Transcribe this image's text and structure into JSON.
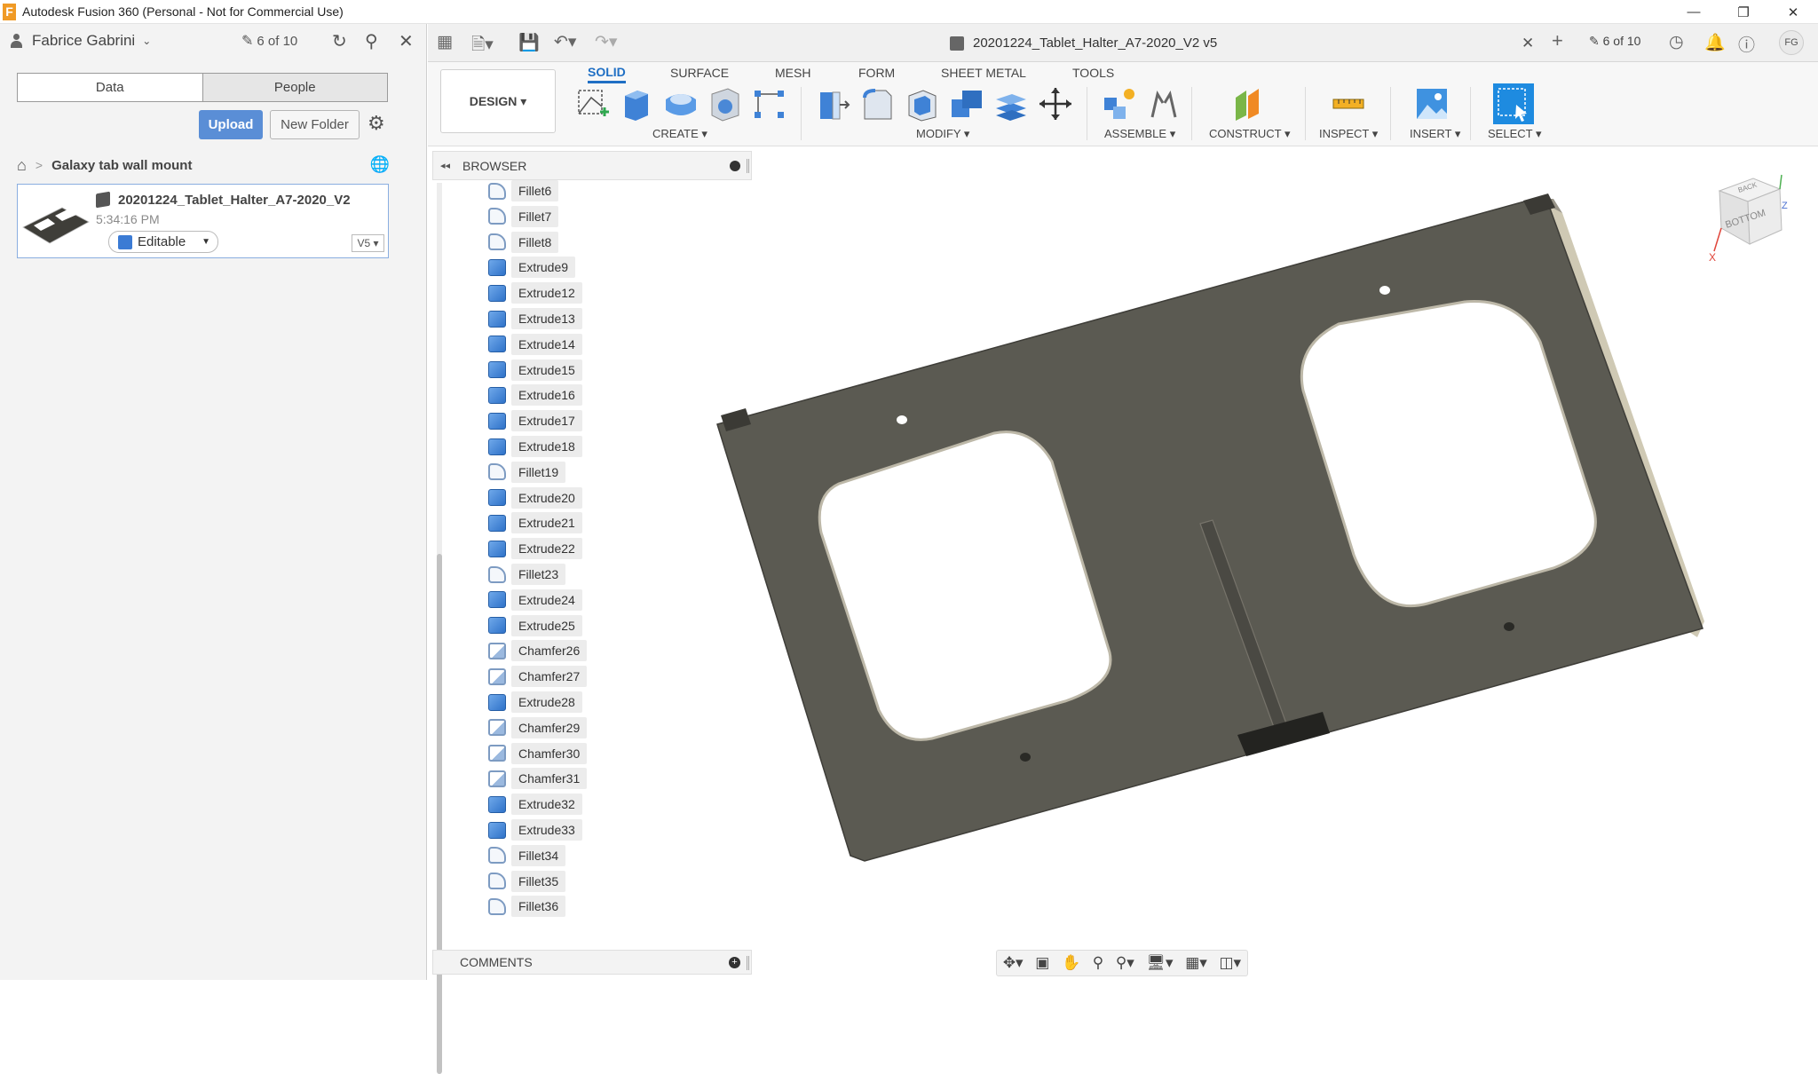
{
  "window": {
    "title": "Autodesk Fusion 360 (Personal - Not for Commercial Use)",
    "logo_letter": "F",
    "minimize": "—",
    "restore": "❐",
    "close": "✕"
  },
  "data_panel": {
    "user_name": "Fabrice Gabrini",
    "user_caret": "⌄",
    "counter": "6 of 10",
    "tabs": {
      "data": "Data",
      "people": "People"
    },
    "upload_label": "Upload",
    "new_folder_label": "New Folder",
    "breadcrumb": {
      "project": "Galaxy tab wall mount",
      "sep": ">"
    },
    "file": {
      "name": "20201224_Tablet_Halter_A7-2020_V2",
      "time": "5:34:16 PM",
      "status": "Editable",
      "version": "V5 ▾"
    }
  },
  "tabbar": {
    "doc_title": "20201224_Tablet_Halter_A7-2020_V2 v5",
    "close": "✕",
    "add": "+",
    "counter": "6 of 10",
    "avatar": "FG"
  },
  "toolbar": {
    "workspace": "DESIGN ▾",
    "tabs": [
      "SOLID",
      "SURFACE",
      "MESH",
      "FORM",
      "SHEET METAL",
      "TOOLS"
    ],
    "groups": {
      "create": "CREATE ▾",
      "modify": "MODIFY ▾",
      "assemble": "ASSEMBLE ▾",
      "construct": "CONSTRUCT ▾",
      "inspect": "INSPECT ▾",
      "insert": "INSERT ▾",
      "select": "SELECT ▾"
    }
  },
  "browser": {
    "label": "BROWSER",
    "collapse": "◂◂",
    "features": [
      {
        "name": "Fillet6",
        "type": "fillet"
      },
      {
        "name": "Fillet7",
        "type": "fillet"
      },
      {
        "name": "Fillet8",
        "type": "fillet"
      },
      {
        "name": "Extrude9",
        "type": "extrude"
      },
      {
        "name": "Extrude12",
        "type": "extrude"
      },
      {
        "name": "Extrude13",
        "type": "extrude"
      },
      {
        "name": "Extrude14",
        "type": "extrude"
      },
      {
        "name": "Extrude15",
        "type": "extrude"
      },
      {
        "name": "Extrude16",
        "type": "extrude"
      },
      {
        "name": "Extrude17",
        "type": "extrude"
      },
      {
        "name": "Extrude18",
        "type": "extrude"
      },
      {
        "name": "Fillet19",
        "type": "fillet"
      },
      {
        "name": "Extrude20",
        "type": "extrude"
      },
      {
        "name": "Extrude21",
        "type": "extrude"
      },
      {
        "name": "Extrude22",
        "type": "extrude"
      },
      {
        "name": "Fillet23",
        "type": "fillet"
      },
      {
        "name": "Extrude24",
        "type": "extrude"
      },
      {
        "name": "Extrude25",
        "type": "extrude"
      },
      {
        "name": "Chamfer26",
        "type": "chamfer"
      },
      {
        "name": "Chamfer27",
        "type": "chamfer"
      },
      {
        "name": "Extrude28",
        "type": "extrude"
      },
      {
        "name": "Chamfer29",
        "type": "chamfer"
      },
      {
        "name": "Chamfer30",
        "type": "chamfer"
      },
      {
        "name": "Chamfer31",
        "type": "chamfer"
      },
      {
        "name": "Extrude32",
        "type": "extrude"
      },
      {
        "name": "Extrude33",
        "type": "extrude"
      },
      {
        "name": "Fillet34",
        "type": "fillet"
      },
      {
        "name": "Fillet35",
        "type": "fillet"
      },
      {
        "name": "Fillet36",
        "type": "fillet"
      }
    ]
  },
  "comments": {
    "label": "COMMENTS",
    "add": "+"
  },
  "viewcube": {
    "top_face": "BACK",
    "front_face": "BOTTOM",
    "x_axis": "X",
    "z_axis": "Z"
  },
  "colors": {
    "accent": "#1f6fc4",
    "upload": "#5a8ed6",
    "part": "#5b5a52",
    "part_edge": "#c9c4b0"
  }
}
